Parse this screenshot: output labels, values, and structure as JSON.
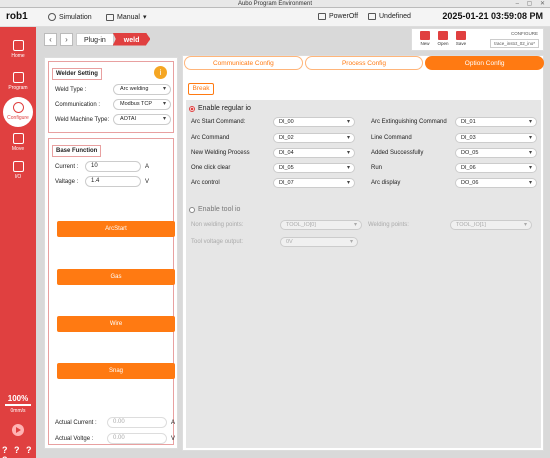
{
  "window": {
    "title": "Aubo Program Environment"
  },
  "topbar": {
    "robot_name": "rob1",
    "mode": "Simulation",
    "run_mode": "Manual",
    "power": "PowerOff",
    "status": "Undefined",
    "datetime": "2025-01-21 03:59:08 PM"
  },
  "sidebar": {
    "items": [
      {
        "label": "Home",
        "icon": "home-icon"
      },
      {
        "label": "Program",
        "icon": "program-icon"
      },
      {
        "label": "Configure",
        "icon": "configure-icon"
      },
      {
        "label": "Move",
        "icon": "move-icon"
      },
      {
        "label": "I/O",
        "icon": "io-icon"
      }
    ],
    "speed": "100%",
    "speed_unit": "0mm/s",
    "help": "? ? ? ?"
  },
  "breadcrumb": {
    "items": [
      "Plug-in",
      "weld"
    ]
  },
  "file_actions": {
    "new": "New",
    "open": "Open",
    "save": "Save",
    "configure_label": "CONFIGURE",
    "file_name": "trace_instct_02_ino*"
  },
  "welder_setting": {
    "title": "Welder Setting",
    "fields": [
      {
        "label": "Weld Type :",
        "value": "Arc welding"
      },
      {
        "label": "Communication :",
        "value": "Modbus TCP"
      },
      {
        "label": "Weld Machine Type:",
        "value": "AOTAI"
      }
    ]
  },
  "base_function": {
    "title": "Base Function",
    "current_label": "Current :",
    "current_value": "10",
    "current_unit": "A",
    "voltage_label": "Valtage :",
    "voltage_value": "1.4",
    "voltage_unit": "V",
    "buttons": [
      "ArcStart",
      "Gas",
      "Wire",
      "Snag"
    ],
    "actual_current_label": "Actual Current :",
    "actual_current_value": "0.00",
    "actual_voltage_label": "Actual Voltge :",
    "actual_voltage_value": "0.00"
  },
  "tabs": [
    "Communicate Config",
    "Process Config",
    "Option Config"
  ],
  "option": {
    "break_label": "Break",
    "regular_io_label": "Enable regular io",
    "regular_io": [
      {
        "label": "Arc Start Command:",
        "value": "DI_00",
        "label2": "Arc Extinguishing Command",
        "value2": "DI_01"
      },
      {
        "label": "Arc Command",
        "value": "DI_02",
        "label2": "Line Command",
        "value2": "DI_03"
      },
      {
        "label": "New Welding Process",
        "value": "DI_04",
        "label2": "Added Successfully",
        "value2": "DO_05"
      },
      {
        "label": "One click clear",
        "value": "DI_05",
        "label2": "Run",
        "value2": "DI_06"
      },
      {
        "label": "Arc control",
        "value": "DI_07",
        "label2": "Arc display",
        "value2": "DO_06"
      }
    ],
    "tool_io_label": "Enable tool io",
    "tool_io": {
      "non_welding_label": "Non welding points:",
      "non_welding_value": "TOOL_IO[0]",
      "welding_label": "Welding points:",
      "welding_value": "TOOL_IO[1]",
      "voltage_label": "Tool voltage output:",
      "voltage_value": "0V"
    }
  }
}
